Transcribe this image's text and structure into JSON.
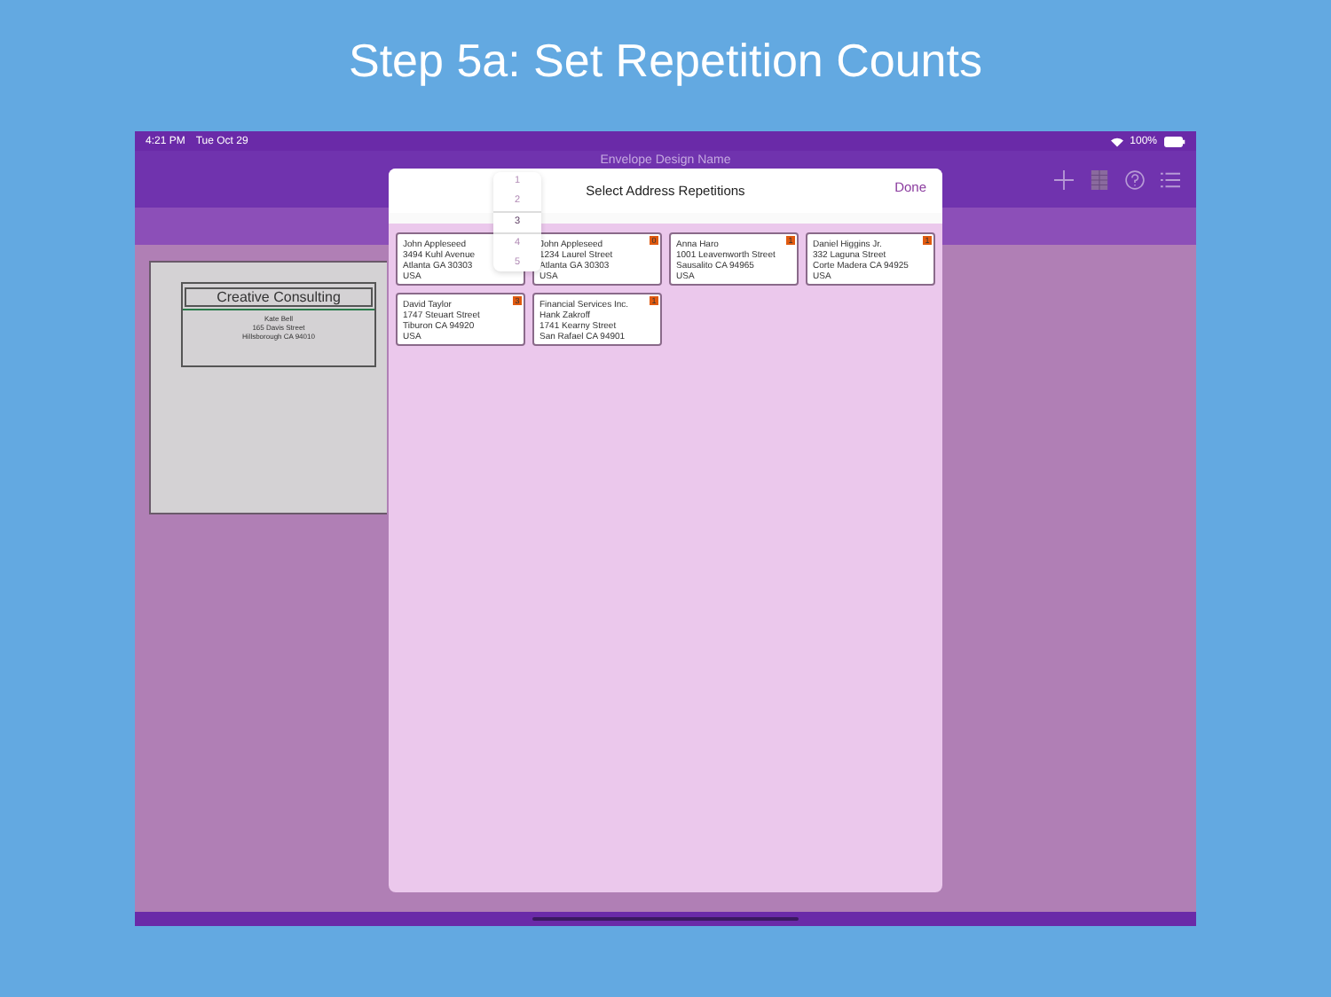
{
  "headline": "Step 5a: Set Repetition Counts",
  "status_bar": {
    "time": "4:21 PM",
    "date": "Tue Oct 29",
    "battery": "100%"
  },
  "window": {
    "title": "Envelope Design Name"
  },
  "envelope": {
    "return_address": "Creative Consulting",
    "recipient_lines": [
      "Kate Bell",
      "165 Davis Street",
      "Hillsborough CA 94010"
    ]
  },
  "dialog": {
    "title": "Select Address Repetitions",
    "done": "Done",
    "cards": [
      {
        "lines": [
          "John Appleseed",
          "3494 Kuhl Avenue",
          "Atlanta GA 30303",
          "USA"
        ]
      },
      {
        "lines": [
          "John Appleseed",
          "1234 Laurel Street",
          "Atlanta GA 30303",
          "USA"
        ],
        "count": "0"
      },
      {
        "lines": [
          "Anna Haro",
          "1001  Leavenworth Street",
          "Sausalito CA 94965",
          "USA"
        ],
        "count": "1"
      },
      {
        "lines": [
          "Daniel Higgins Jr.",
          "332 Laguna Street",
          "Corte Madera CA 94925",
          "USA"
        ],
        "count": "1"
      },
      {
        "lines": [
          "David Taylor",
          "1747 Steuart Street",
          "Tiburon CA 94920",
          "USA"
        ],
        "count": "3"
      },
      {
        "lines": [
          "Financial Services Inc.",
          "Hank Zakroff",
          "1741 Kearny Street",
          "San Rafael CA 94901"
        ],
        "count": "1"
      }
    ],
    "picker": [
      {
        "label": "1",
        "selected": false
      },
      {
        "label": "2",
        "selected": false
      },
      {
        "label": "3",
        "selected": true
      },
      {
        "label": "4",
        "selected": false
      },
      {
        "label": "5",
        "selected": false
      }
    ]
  }
}
